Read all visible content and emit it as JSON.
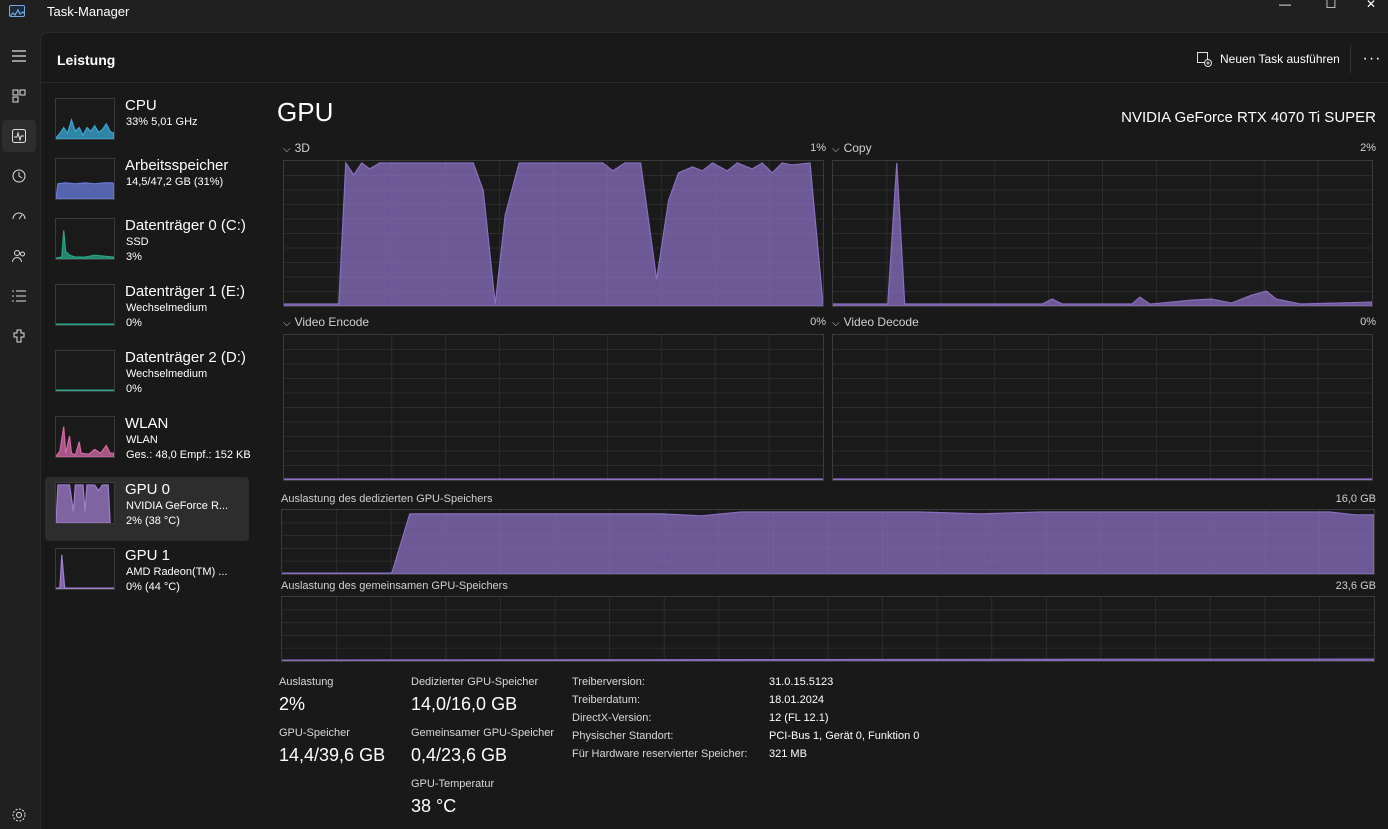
{
  "window": {
    "title": "Task-Manager",
    "controls": {
      "minimize": "—",
      "maximize": "☐",
      "close": "✕"
    }
  },
  "nav_rail": {
    "items": [
      {
        "icon": "hamburger-menu-icon"
      },
      {
        "icon": "processes-icon"
      },
      {
        "icon": "performance-icon",
        "active": true
      },
      {
        "icon": "app-history-icon"
      },
      {
        "icon": "startup-apps-icon"
      },
      {
        "icon": "users-icon"
      },
      {
        "icon": "details-icon"
      },
      {
        "icon": "services-icon"
      },
      {
        "icon": "settings-icon"
      }
    ]
  },
  "header": {
    "title": "Leistung",
    "run_task_label": "Neuen Task ausführen",
    "more_label": "···"
  },
  "sidebar": {
    "items": [
      {
        "name": "CPU",
        "line1": "33% 5,01 GHz",
        "line2": "",
        "color": "#3aa9d6"
      },
      {
        "name": "Arbeitsspeicher",
        "line1": "14,5/47,2 GB (31%)",
        "line2": "",
        "color": "#6a7de0"
      },
      {
        "name": "Datenträger 0 (C:)",
        "line1": "SSD",
        "line2": "3%",
        "color": "#2aa58a"
      },
      {
        "name": "Datenträger 1 (E:)",
        "line1": "Wechselmedium",
        "line2": "0%",
        "color": "#2aa58a"
      },
      {
        "name": "Datenträger 2 (D:)",
        "line1": "Wechselmedium",
        "line2": "0%",
        "color": "#2aa58a"
      },
      {
        "name": "WLAN",
        "line1": "WLAN",
        "line2": "Ges.: 48,0 Empf.: 152 KB",
        "color": "#d66aa8"
      },
      {
        "name": "GPU 0",
        "line1": "NVIDIA GeForce R...",
        "line2": "2% (38 °C)",
        "color": "#a07fd0",
        "active": true
      },
      {
        "name": "GPU 1",
        "line1": "AMD Radeon(TM) ...",
        "line2": "0% (44 °C)",
        "color": "#a07fd0"
      }
    ]
  },
  "gpu": {
    "title": "GPU",
    "model": "NVIDIA GeForce RTX 4070 Ti SUPER",
    "accent_color": "#8a6fc0",
    "engines": [
      {
        "label": "3D",
        "value": "1%"
      },
      {
        "label": "Copy",
        "value": "2%"
      },
      {
        "label": "Video Encode",
        "value": "0%"
      },
      {
        "label": "Video Decode",
        "value": "0%"
      }
    ],
    "dedicated_memory_graph": {
      "label": "Auslastung des dedizierten GPU-Speichers",
      "max": "16,0 GB"
    },
    "shared_memory_graph": {
      "label": "Auslastung des gemeinsamen GPU-Speichers",
      "max": "23,6 GB"
    }
  },
  "stats": {
    "utilization": {
      "label": "Auslastung",
      "value": "2%"
    },
    "gpu_memory": {
      "label": "GPU-Speicher",
      "value": "14,4/39,6 GB"
    },
    "dedicated_memory": {
      "label": "Dedizierter GPU-Speicher",
      "value": "14,0/16,0 GB"
    },
    "shared_memory": {
      "label": "Gemeinsamer GPU-Speicher",
      "value": "0,4/23,6 GB"
    },
    "temperature": {
      "label": "GPU-Temperatur",
      "value": "38 °C"
    }
  },
  "driver_info": [
    {
      "key": "Treiberversion:",
      "value": "31.0.15.5123"
    },
    {
      "key": "Treiberdatum:",
      "value": "18.01.2024"
    },
    {
      "key": "DirectX-Version:",
      "value": "12 (FL 12.1)"
    },
    {
      "key": "Physischer Standort:",
      "value": "PCI-Bus 1, Gerät 0, Funktion 0"
    },
    {
      "key": "Für Hardware reservierter Speicher:",
      "value": "321 MB"
    }
  ]
}
